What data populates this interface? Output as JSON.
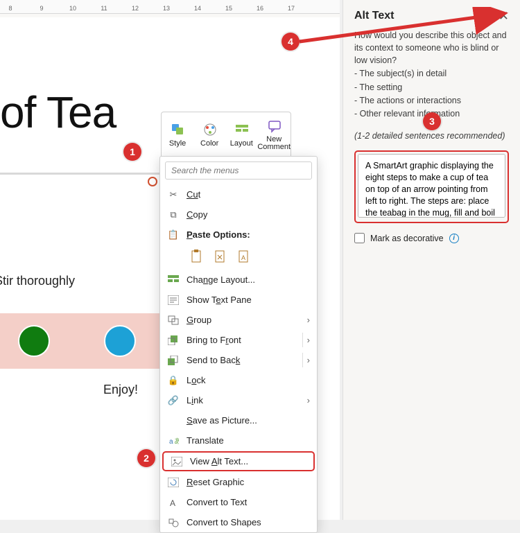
{
  "ruler": {
    "marks": [
      "8",
      "9",
      "10",
      "11",
      "12",
      "13",
      "14",
      "15",
      "16",
      "17"
    ]
  },
  "title": "of Tea",
  "format_toolbar": {
    "style": "Style",
    "color": "Color",
    "layout": "Layout",
    "new_comment": "New Comment"
  },
  "diagram": {
    "label1": "Stir thoroughly",
    "label2": "Enjoy!"
  },
  "context_menu": {
    "search_placeholder": "Search the menus",
    "cut": "Cut",
    "copy": "Copy",
    "paste_options": "Paste Options:",
    "change_layout": "Change Layout...",
    "show_text_pane": "Show Text Pane",
    "group": "Group",
    "bring_to_front": "Bring to Front",
    "send_to_back": "Send to Back",
    "lock": "Lock",
    "link": "Link",
    "save_as_picture": "Save as Picture...",
    "translate": "Translate",
    "view_alt_text": "View Alt Text...",
    "reset_graphic": "Reset Graphic",
    "convert_to_text": "Convert to Text",
    "convert_to_shapes": "Convert to Shapes"
  },
  "alt_panel": {
    "title": "Alt Text",
    "desc": "How would you describe this object and its context to someone who is blind or low vision?",
    "b1": "- The subject(s) in detail",
    "b2": "- The setting",
    "b3": "- The actions or interactions",
    "b4": "- Other relevant information",
    "hint": "(1-2 detailed sentences recommended)",
    "textarea": "A SmartArt graphic displaying the eight steps to make a cup of tea on top of an arrow pointing from left to right. The steps are: place the teabag in the mug, fill and boil the kettle,",
    "decorative": "Mark as decorative"
  },
  "callouts": {
    "c1": "1",
    "c2": "2",
    "c3": "3",
    "c4": "4"
  }
}
